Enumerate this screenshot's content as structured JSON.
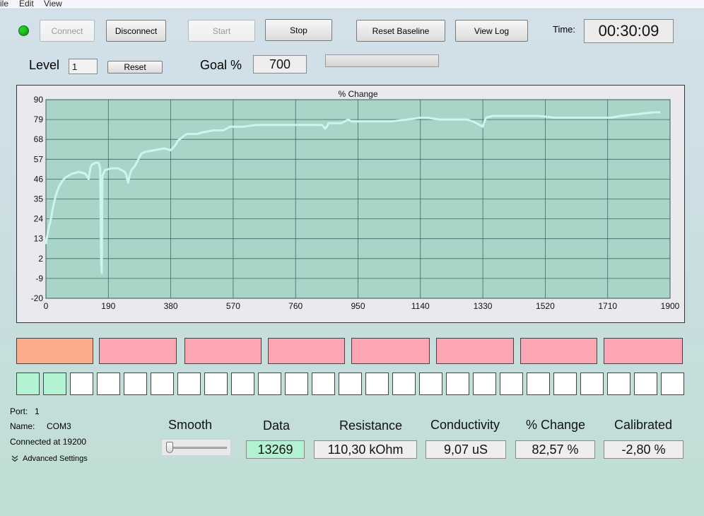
{
  "menu": [
    "ile",
    "Edit",
    "View"
  ],
  "colors": {
    "status_led": "#22cc22",
    "chart_bg": "#a8d5c8",
    "line": "#c9f6ef",
    "orange": "#fcac8c",
    "pink": "#fba6b2",
    "green": "#b4f3d2"
  },
  "status_led_icon": "status-led-icon",
  "toolbar": {
    "connect": "Connect",
    "disconnect": "Disconnect",
    "start": "Start",
    "stop": "Stop",
    "reset_baseline": "Reset Baseline",
    "view_log": "View Log",
    "time_label": "Time:",
    "time_value": "00:30:09"
  },
  "level": {
    "label": "Level",
    "value": "1",
    "reset": "Reset"
  },
  "goal": {
    "label": "Goal %",
    "value": "700",
    "progress": 0
  },
  "chart_data": {
    "type": "line",
    "title": "% Change",
    "xlim": [
      0,
      1900
    ],
    "ylim": [
      -20,
      90
    ],
    "xticks": [
      0,
      190,
      380,
      570,
      760,
      950,
      1140,
      1330,
      1520,
      1710,
      1900
    ],
    "yticks": [
      90,
      79,
      68,
      57,
      46,
      35,
      24,
      13,
      2,
      -9,
      -20
    ],
    "grid": true,
    "series": [
      {
        "x": [
          0,
          5,
          10,
          15,
          20,
          25,
          30,
          40,
          50,
          60,
          80,
          100,
          120,
          130,
          135,
          140,
          150,
          160,
          165,
          168,
          170,
          172,
          180,
          200,
          220,
          240,
          245,
          250,
          255,
          260,
          270,
          290,
          300,
          330,
          360,
          380,
          395,
          400,
          420,
          430,
          460,
          480,
          510,
          540,
          560,
          570,
          600,
          640,
          680,
          720,
          760,
          800,
          840,
          850,
          855,
          860,
          880,
          900,
          910,
          920,
          930,
          950,
          1000,
          1050,
          1100,
          1140,
          1160,
          1200,
          1240,
          1280,
          1300,
          1310,
          1320,
          1330,
          1335,
          1340,
          1360,
          1400,
          1450,
          1500,
          1550,
          1600,
          1650,
          1700,
          1720,
          1750,
          1800,
          1850,
          1870
        ],
        "y": [
          10,
          16,
          20,
          24,
          29,
          33,
          37,
          42,
          45,
          47,
          49,
          50,
          49,
          46,
          52,
          54,
          55,
          55,
          52,
          0,
          -6,
          48,
          51,
          52,
          52,
          50,
          48,
          44,
          48,
          51,
          53,
          60,
          61,
          62,
          63,
          62,
          65,
          67,
          70,
          71,
          71,
          72,
          73,
          73,
          75,
          75,
          75,
          76,
          76,
          76,
          76,
          76,
          76,
          74,
          75,
          77,
          77,
          77,
          78,
          79,
          78,
          78,
          78,
          78,
          79,
          80,
          80,
          79,
          79,
          79,
          78,
          77,
          76,
          75,
          78,
          80,
          81,
          81,
          81,
          81,
          80,
          80,
          80,
          80,
          80,
          81,
          82,
          83,
          83
        ]
      }
    ]
  },
  "indicators": {
    "big": [
      "orange",
      "pink",
      "pink",
      "pink",
      "pink",
      "pink",
      "pink",
      "pink"
    ],
    "small": [
      "green",
      "green",
      "empty",
      "empty",
      "empty",
      "empty",
      "empty",
      "empty",
      "empty",
      "empty",
      "empty",
      "empty",
      "empty",
      "empty",
      "empty",
      "empty",
      "empty",
      "empty",
      "empty",
      "empty",
      "empty",
      "empty",
      "empty",
      "empty",
      "empty"
    ]
  },
  "info": {
    "port_label": "Port:",
    "port_value": "1",
    "name_label": "Name:",
    "name_value": "COM3",
    "connected": "Connected at 19200",
    "advanced": "Advanced Settings",
    "advanced_icon": "double-chevron-down-icon"
  },
  "readouts": {
    "smooth": "Smooth",
    "smooth_level": 0,
    "data_label": "Data",
    "data_value": "13269",
    "resistance_label": "Resistance",
    "resistance_value": "110,30 kOhm",
    "conductivity_label": "Conductivity",
    "conductivity_value": "9,07 uS",
    "change_label": "% Change",
    "change_value": "82,57 %",
    "calibrated_label": "Calibrated",
    "calibrated_value": "-2,80 %"
  }
}
